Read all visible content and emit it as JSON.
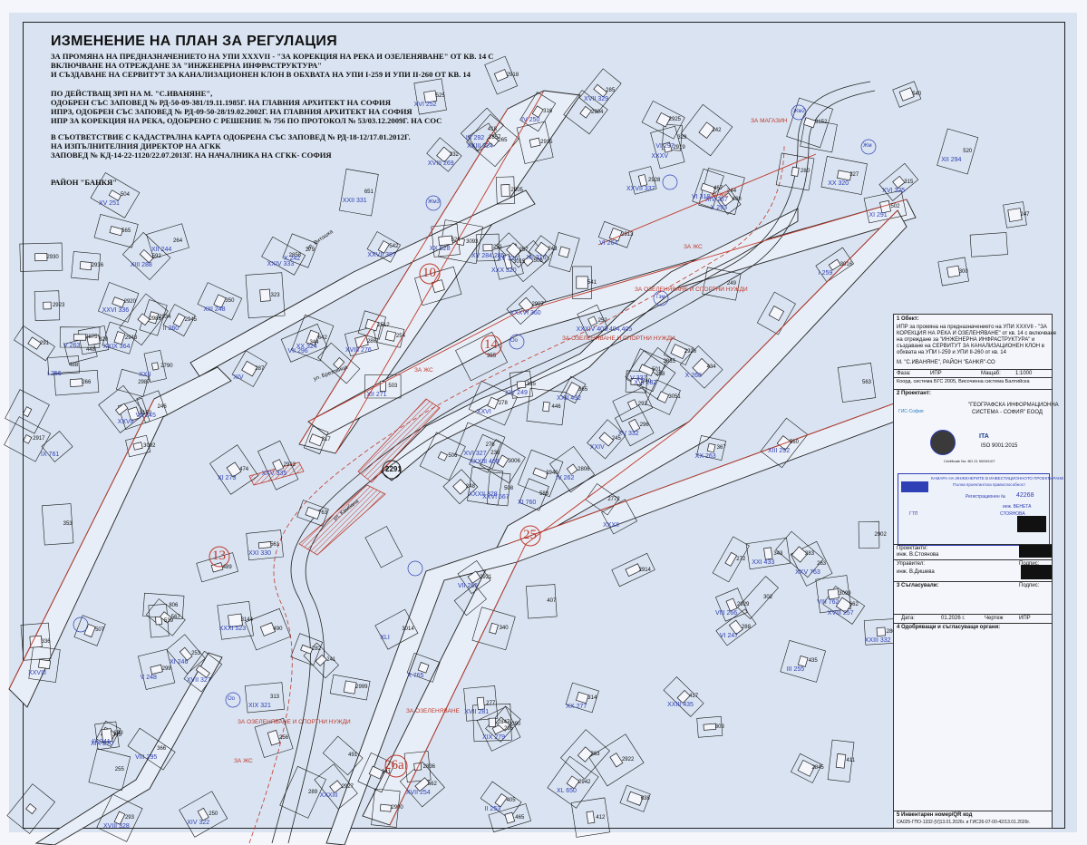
{
  "title": "ИЗМЕНЕНИЕ НА ПЛАН ЗА РЕГУЛАЦИЯ",
  "header_lines": [
    "ЗА ПРОМЯНА НА ПРЕДНАЗНАЧЕНИЕТО НА УПИ XXXVII - \"ЗА КОРЕКЦИЯ НА РЕКА И ОЗЕЛЕНЯВАНЕ\" ОТ КВ. 14 С",
    "ВКЛЮЧВАНЕ НА ОТРЕЖДАНЕ ЗА \"ИНЖЕНЕРНА ИНФРАСТРУКТУРА\"",
    "И СЪЗДАВАНЕ НА СЕРВИТУТ ЗА КАНАЛИЗАЦИОНЕН КЛОН В ОБХВАТА НА УПИ I-259 И УПИ II-260 ОТ КВ. 14"
  ],
  "basis_lines": [
    "ПО ДЕЙСТВАЩ ЗРП НА М. \"С.ИВАНЯНЕ\",",
    "ОДОБРЕН СЪС ЗАПОВЕД № РД-50-09-381/19.11.1985Г. НА ГЛАВНИЯ АРХИТЕКТ НА СОФИЯ",
    "ИПРЗ, ОДОБРЕН СЪС ЗАПОВЕД № РД-09-50-28/19.02.2002Г. НА ГЛАВНИЯ АРХИТЕКТ НА СОФИЯ",
    "ИПР ЗА КОРЕКЦИЯ НА РЕКА, ОДОБРЕНО С РЕШЕНИЕ № 756 ПО ПРОТОКОЛ № 53/03.12.2009Г. НА СОС"
  ],
  "cadastre_lines": [
    "В СЪОТВЕТСТВИЕ С КАДАСТРАЛНА КАРТА ОДОБРЕНА СЪС ЗАПОВЕД № РД-18-12/17.01.2012Г.",
    "НА ИЗПЪЛНИТЕЛНИЯ ДИРЕКТОР НА АГКК",
    "ЗАПОВЕД № КД-14-22-1120/22.07.2013Г. НА НАЧАЛНИКА НА СГКК- СОФИЯ"
  ],
  "district": "РАЙОН \"БАНКЯ\"",
  "quarters": [
    "10",
    "14",
    "13",
    "25",
    "26а",
    "2291"
  ],
  "parcel_labels": [
    "588",
    "592",
    "238",
    "239",
    "240",
    "241",
    "242",
    "243",
    "244",
    "245",
    "246",
    "247",
    "248",
    "249",
    "250",
    "251",
    "252",
    "253",
    "254",
    "255",
    "256",
    "257",
    "258",
    "263",
    "264",
    "265",
    "266",
    "272",
    "276",
    "277",
    "278",
    "279",
    "280",
    "282",
    "283",
    "285",
    "286",
    "287",
    "288",
    "289",
    "291",
    "292",
    "293",
    "295",
    "296",
    "299",
    "300",
    "302",
    "303",
    "313",
    "314",
    "315",
    "316",
    "317",
    "320",
    "323",
    "327",
    "329",
    "332",
    "335",
    "336",
    "340",
    "341",
    "343",
    "344",
    "345",
    "350",
    "353",
    "355",
    "363",
    "365",
    "366",
    "367",
    "405",
    "407",
    "411",
    "412",
    "417",
    "418",
    "434",
    "435",
    "446",
    "448",
    "465",
    "467",
    "468",
    "474",
    "488",
    "489",
    "490",
    "491",
    "501",
    "502",
    "503",
    "504",
    "505",
    "506",
    "507",
    "508",
    "520",
    "524",
    "525",
    "539",
    "540",
    "541",
    "542",
    "560",
    "561",
    "562",
    "563",
    "565",
    "567",
    "638",
    "642",
    "651",
    "662",
    "763",
    "806",
    "2512",
    "2772",
    "2790",
    "2805",
    "2806",
    "2835",
    "2836",
    "2845",
    "2847",
    "2857",
    "2858",
    "2875",
    "2900",
    "2902",
    "2904",
    "2905",
    "2907",
    "2912",
    "2913",
    "2914",
    "2915",
    "2917",
    "2918",
    "2919",
    "2920",
    "2921",
    "2922",
    "2923",
    "2925",
    "2926",
    "2927",
    "2928",
    "2929",
    "2930",
    "2934",
    "2936",
    "2940",
    "2942",
    "2943",
    "2945",
    "2986",
    "2987",
    "2999",
    "3006",
    "3014",
    "3015",
    "3016",
    "3051",
    "3090",
    "3092",
    "3093",
    "3099",
    "3144",
    "3150",
    "3152"
  ],
  "upi_labels": [
    "IX 241",
    "VII 245",
    "XI 246",
    "XII 244",
    "X 242",
    "VI 247",
    "V 248",
    "IV 250",
    "XIV 249",
    "XIII 248",
    "II 253",
    "III 255",
    "I 256",
    "XV 251",
    "XVI 252",
    "XVII 254",
    "XVIII 257",
    "IV 262",
    "V 263",
    "VI 264",
    "VII 265",
    "VIII 266",
    "II 260",
    "I 259",
    "XXVII",
    "XXVIII",
    "XXXII",
    "XXXIII 468",
    "XXIV",
    "XXXIV 403,404,405",
    "XXV 763",
    "XXVI",
    "XIV",
    "XV 332",
    "XVI 325",
    "XVIII 269",
    "XIX 270",
    "XX 263",
    "X 268",
    "XI 273",
    "XII 271",
    "XX 328",
    "XXI 330",
    "XXII 331",
    "XXIII 332",
    "XXIV 333",
    "XXV 335",
    "XXVI 336",
    "XXVII 337",
    "XXIX 364",
    "XXX 320",
    "XXXI 523",
    "XXXII 328",
    "XVII 327",
    "XIII 288",
    "XIV 287",
    "XV 284,285",
    "XVI 282",
    "XVII 281",
    "XVIII 276",
    "XIX 279",
    "XX 277",
    "VI 297",
    "VII 296",
    "VIII 295",
    "IX 292",
    "X 293",
    "XI 291",
    "XII 294",
    "XIII 292",
    "XX 324",
    "XXII",
    "XXIII 324",
    "XXXVI 360",
    "XXXV",
    "XXXIII",
    "XL 650",
    "XLI",
    "VIII 762",
    "IX 761",
    "X 765",
    "XI 760",
    "XII 316",
    "XIV 322",
    "XV 326",
    "XVI 327",
    "XVII 329",
    "XVIII 328",
    "XIX 321",
    "XX 320",
    "XXI 433",
    "XXII 432",
    "XXIII 435",
    "VI 318",
    "V 337",
    "XXVI 667",
    "XXVII 387"
  ],
  "zone_labels": [
    "ЗА ЖС",
    "ЗА ОЗЕЛЕНЯВАНЕ И СПОРТНИ НУЖДИ",
    "ЗА МАГАЗИН",
    "ЗА ОЗЕЛЕНЯВАНЕ",
    "Жм",
    "Жм3",
    "Озн",
    "Тзм",
    "Оо",
    "Жм2"
  ],
  "streets": [
    "ул. Брезовица",
    "ул. Камбана",
    "ул. Витошка"
  ],
  "title_block": {
    "s1_title": "1 Обект:",
    "s1_text": [
      "ИПР за промяна на предназначението на УПИ XXXVII - \"ЗА",
      "КОРЕКЦИЯ НА РЕКА И ОЗЕЛЕНЯВАНЕ\" от кв. 14 с включване",
      "на отреждане за \"ИНЖЕНЕРНА ИНФРАСТРУКТУРА\" и",
      "създаване на СЕРВИТУТ ЗА КАНАЛИЗАЦИОНЕН КЛОН в",
      "обхвата на УПИ I-259 и УПИ II-260 от кв. 14"
    ],
    "s1_place": "М. \"С.ИВАНЯНЕ\", РАЙОН \"БАНКЯ\"-СО",
    "phase_label": "Фаза:",
    "phase": "ИПР",
    "scale_label": "Мащаб:",
    "scale": "1:1000",
    "coords": "Коорд. система БГС 2005, Височинна система Балтийска",
    "s2_title": "2 Проектант:",
    "org_line1": "\"ГЕОГРАФСКА ИНФОРМАЦИОННА",
    "org_line2": "СИСТЕМА - СОФИЯ\" ЕООД",
    "org_short": "ГИС-София",
    "iso": "ISO 9001:2015",
    "iso_cert": "Certificate No: ВО 21 9009/1/07",
    "chamber": "КАМАРА НА ИНЖЕНЕРИТЕ В ИНВЕСТИЦИОННОТО ПРОЕКТИРАНЕ",
    "chamber2": "Пълна проектантска правоспособност",
    "reg_no_label": "Регистрационен №",
    "reg_no": "42268",
    "eng_name": "инж. ВЕНЕТА",
    "eng_name2": "СТОЯНОВА",
    "sect": "ГТП",
    "designers_label": "Проектанти:",
    "designer": "инж. В.Стоянова",
    "sign_label": "Подпис:",
    "manager_label": "Управител:",
    "manager": "инж. В.Дишева",
    "s3_title": "3 Съгласували:",
    "s3_sign": "Подпис:",
    "date_label": "Дата:",
    "date": "01.2026 г.",
    "drawing_label": "Чертеж",
    "drawing": "ИПР",
    "s4_title": "4 Одобряващи и съгласуващи органи:",
    "s5_title": "5 Инвентарен номер/QR код",
    "s5_text": "СА025-ГПО-1332-[V]13.01.2026г. и ГИС26-07-00-42/13.01.2026г."
  },
  "colors": {
    "parcel_line": "#1a1a1a",
    "upi_blue": "#2f3fb5",
    "regulation_red": "#c0392b",
    "paper": "#d9e3f1",
    "street": "#e8eef7"
  }
}
